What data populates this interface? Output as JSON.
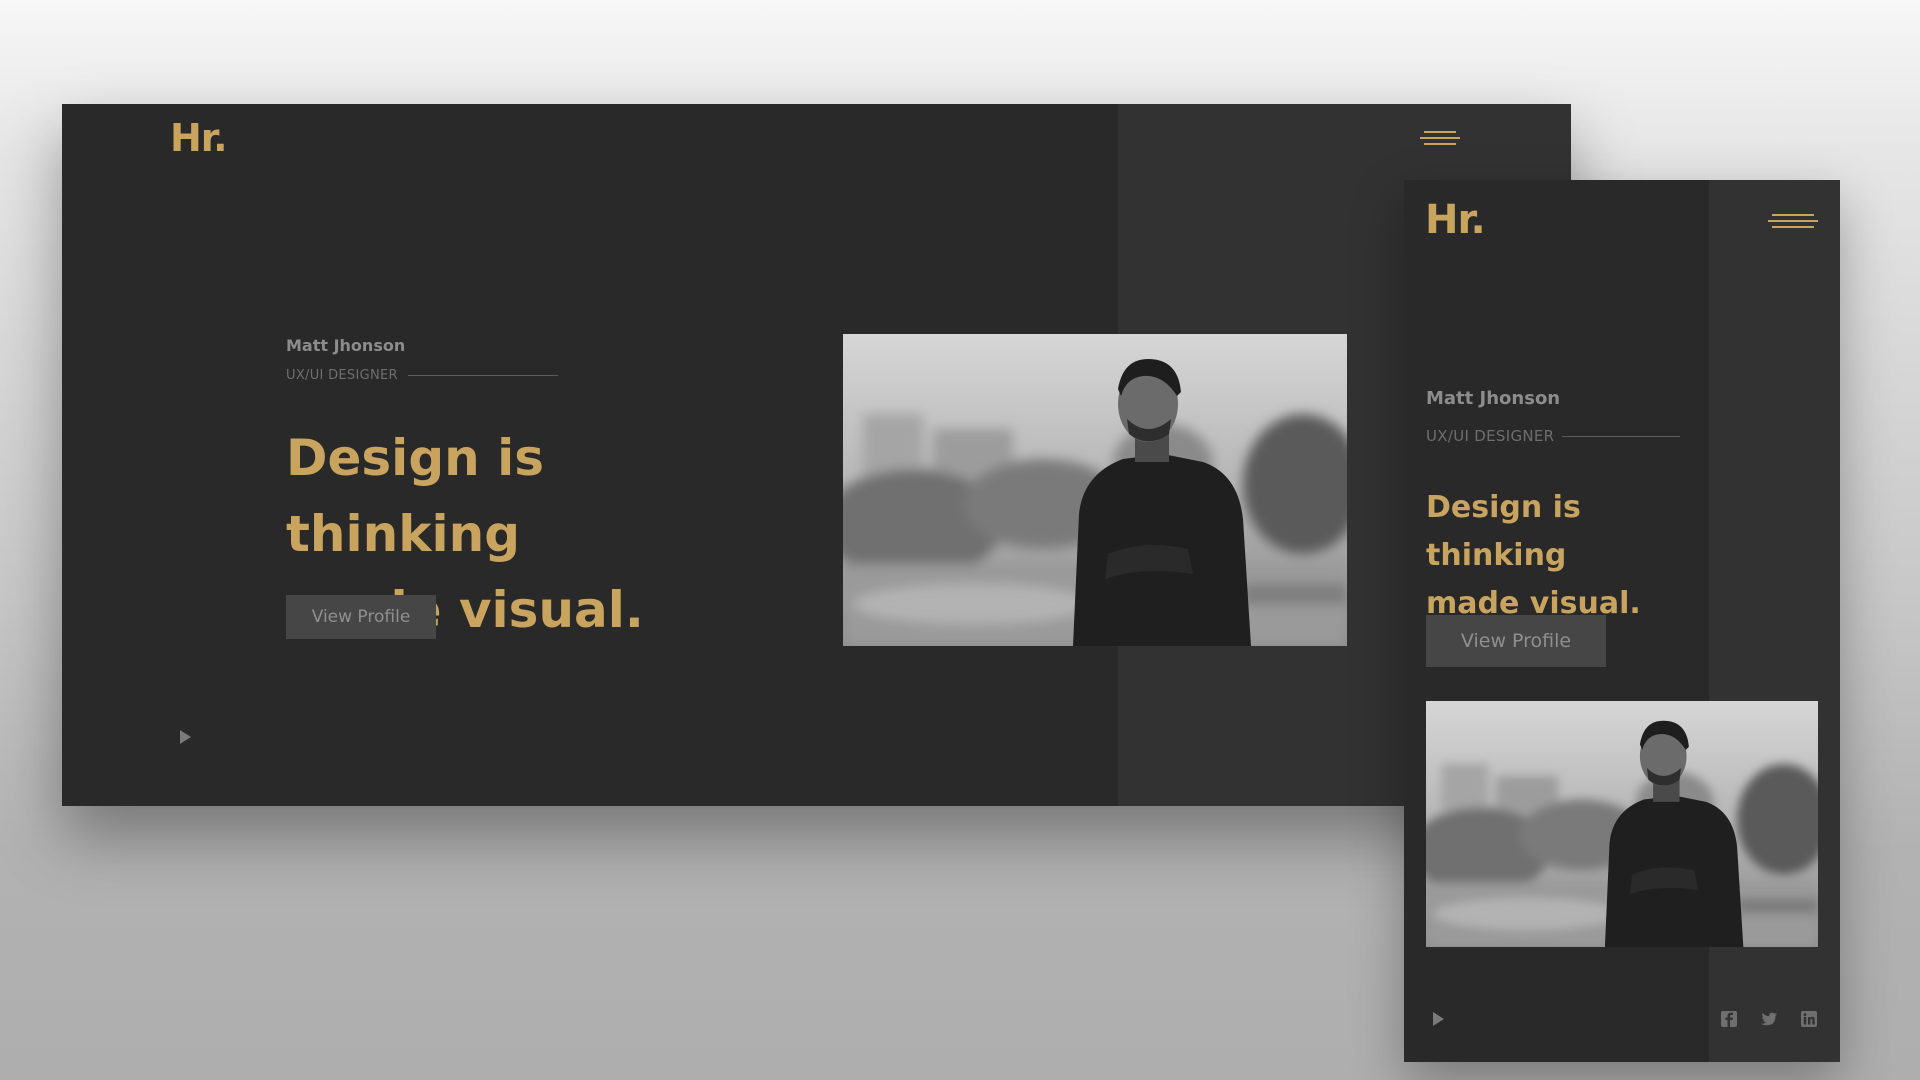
{
  "brand": {
    "logo": "Hr."
  },
  "profile": {
    "name": "Matt Jhonson",
    "role": "UX/UI DESIGNER",
    "headline_line1": "Design is thinking",
    "headline_line2": "made visual.",
    "cta_label": "View Profile"
  },
  "icons": {
    "menu": "hamburger-menu-icon",
    "play": "play-icon",
    "social": [
      "facebook-icon",
      "twitter-icon",
      "linkedin-icon"
    ]
  },
  "colors": {
    "accent": "#c9a45f",
    "background": "#292929",
    "panel": "#323232",
    "button": "#464646"
  }
}
